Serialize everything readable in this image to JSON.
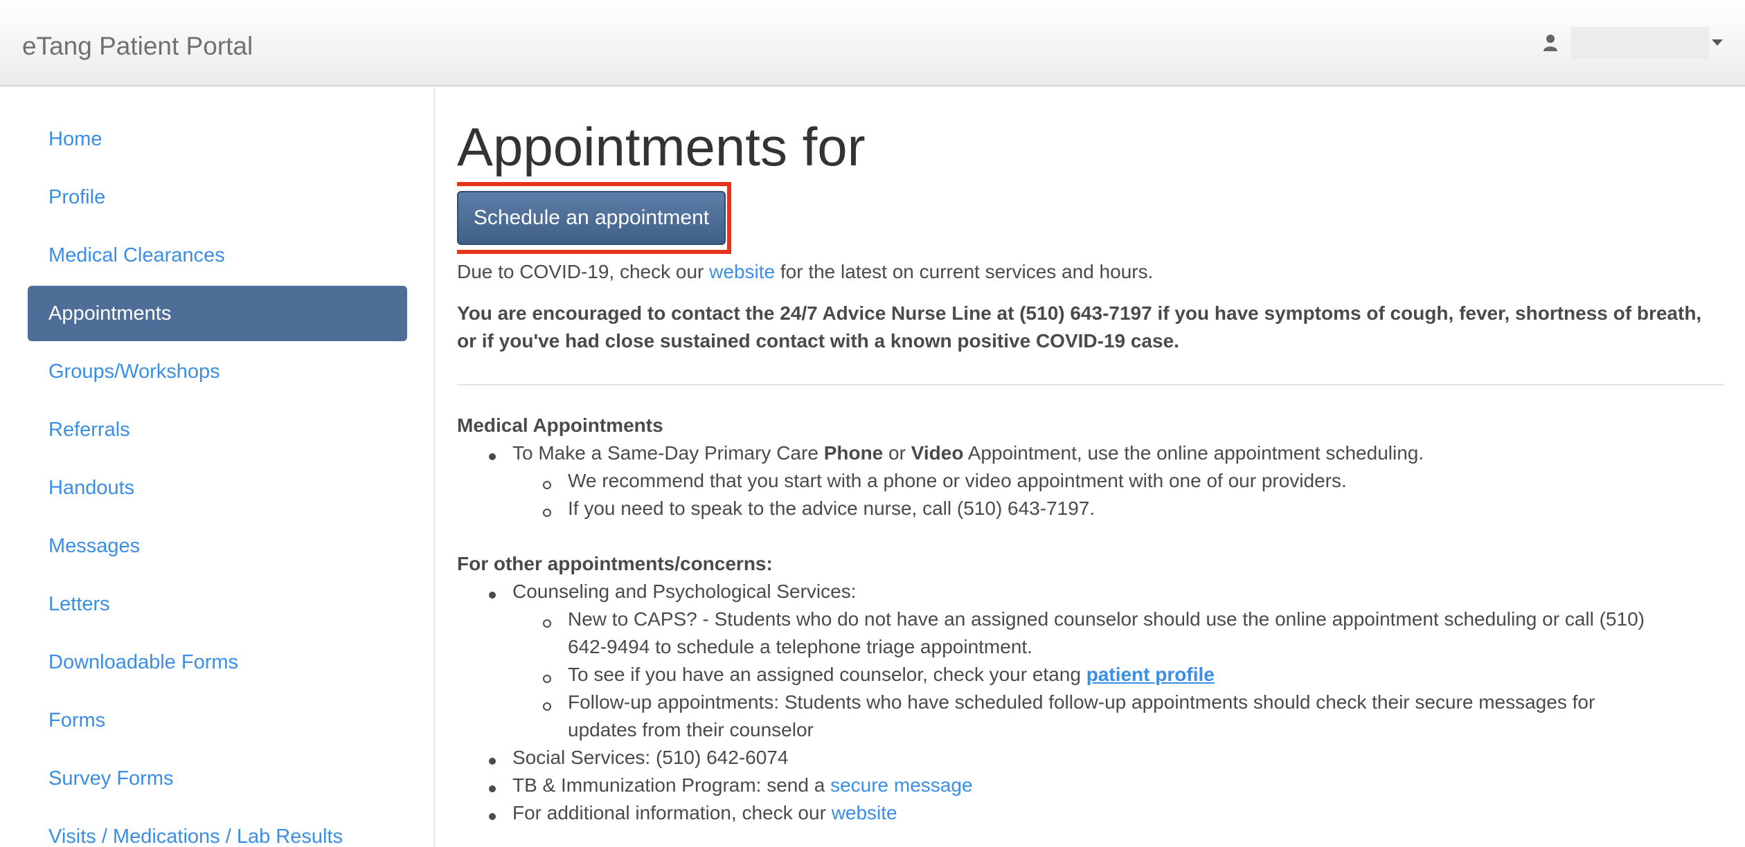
{
  "header": {
    "brand": "eTang Patient Portal",
    "user_icon": "user-icon",
    "caret_icon": "caret-down-icon"
  },
  "sidebar": {
    "items": [
      {
        "label": "Home"
      },
      {
        "label": "Profile"
      },
      {
        "label": "Medical Clearances"
      },
      {
        "label": "Appointments",
        "active": true
      },
      {
        "label": "Groups/Workshops"
      },
      {
        "label": "Referrals"
      },
      {
        "label": "Handouts"
      },
      {
        "label": "Messages"
      },
      {
        "label": "Letters"
      },
      {
        "label": "Downloadable Forms"
      },
      {
        "label": "Forms"
      },
      {
        "label": "Survey Forms"
      },
      {
        "label": "Visits / Medications / Lab Results"
      }
    ]
  },
  "main": {
    "title": "Appointments for",
    "schedule_button": "Schedule an appointment",
    "covid": {
      "prefix": "Due to COVID-19, check our ",
      "link": "website",
      "suffix": " for the latest on current services and hours."
    },
    "advice": "You are encouraged to contact the 24/7 Advice Nurse Line at (510) 643-7197 if you have symptoms of cough, fever, shortness of breath, or if you've had close sustained contact with a known positive COVID-19 case.",
    "medical": {
      "heading": "Medical Appointments",
      "item1": {
        "a": "To Make a Same-Day Primary Care ",
        "phone": "Phone",
        "or": " or ",
        "video": "Video",
        "b": " Appointment, use the online appointment scheduling."
      },
      "sub1": "We recommend that you start with a phone or video appointment with one of our providers.",
      "sub2": "If you need to speak to the advice nurse, call (510) 643-7197."
    },
    "other": {
      "heading": "For other appointments/concerns:",
      "counseling": "Counseling and Psychological Services:",
      "caps_line1": "New to CAPS? - Students who do not have an assigned counselor should use the online appointment scheduling or call (510)",
      "caps_line2": "642-9494 to schedule a telephone triage appointment.",
      "assigned_prefix": "To see if you have an assigned counselor, check your etang ",
      "assigned_link": "patient profile",
      "followup_line1": "Follow-up appointments: Students who have scheduled follow-up appointments should check their secure messages for",
      "followup_line2": "updates from their counselor",
      "social": "Social Services: (510) 642-6074",
      "tb_prefix": "TB & Immunization Program: send a ",
      "tb_link": "secure message",
      "additional_prefix": "For additional information, check our ",
      "additional_link": "website"
    }
  }
}
